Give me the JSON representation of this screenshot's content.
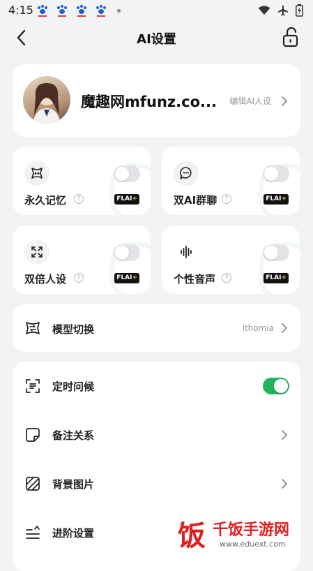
{
  "status": {
    "time": "4:15"
  },
  "header": {
    "title": "AI设置"
  },
  "profile": {
    "name": "魔趣网mfunz.co...",
    "edit_label": "编辑AI人设"
  },
  "features": [
    {
      "label": "永久记忆",
      "badge": "FLAI",
      "badge_plus": "+",
      "enabled": false
    },
    {
      "label": "双AI群聊",
      "badge": "FLAI",
      "badge_plus": "+",
      "enabled": false
    },
    {
      "label": "双倍人设",
      "badge": "FLAI",
      "badge_plus": "+",
      "enabled": false
    },
    {
      "label": "个性音声",
      "badge": "FLAI",
      "badge_plus": "+",
      "enabled": false
    }
  ],
  "model": {
    "label": "模型切换",
    "value": "Ithomia"
  },
  "settings": [
    {
      "label": "定时问候",
      "toggle": true
    },
    {
      "label": "备注关系"
    },
    {
      "label": "背景图片"
    },
    {
      "label": "进阶设置"
    }
  ],
  "watermark": {
    "char": "饭",
    "brand": "千饭手游网",
    "url": "www.eduext.com"
  },
  "colors": {
    "accent_green": "#22b35f",
    "badge_plus": "#f5c24b",
    "watermark_red": "#e02020"
  }
}
